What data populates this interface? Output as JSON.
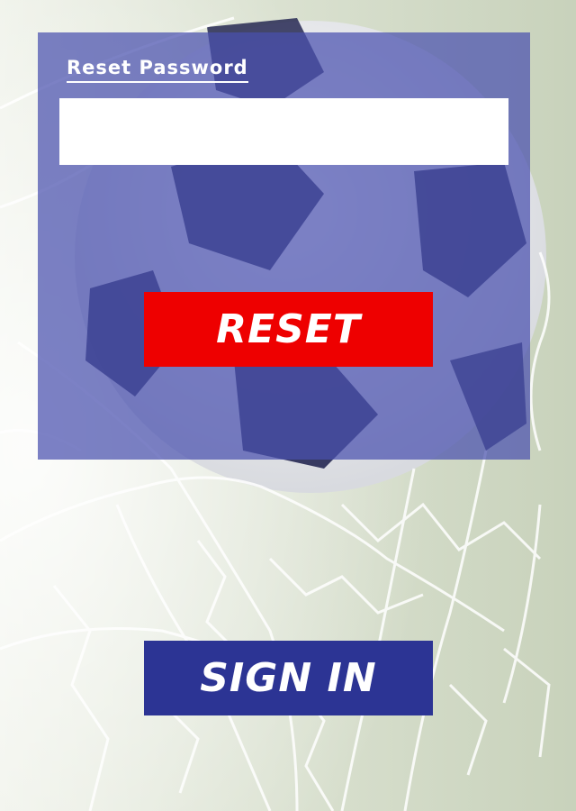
{
  "reset_form": {
    "title": "Reset Password",
    "password_value": "",
    "reset_label": "RESET"
  },
  "signin": {
    "label": "SIGN IN"
  },
  "colors": {
    "panel": "#4950af",
    "reset_button": "#ee0000",
    "signin_button": "#2c3494"
  }
}
